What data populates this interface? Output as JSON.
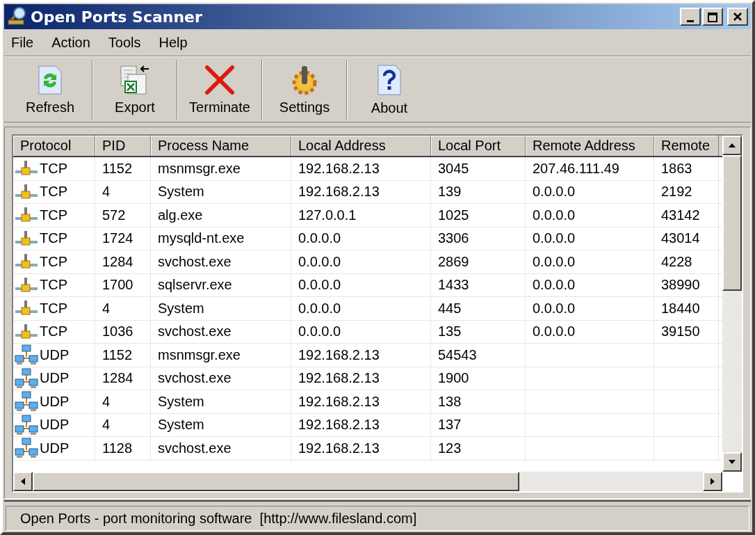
{
  "window": {
    "title": "Open Ports Scanner"
  },
  "menu": [
    "File",
    "Action",
    "Tools",
    "Help"
  ],
  "toolbar": [
    {
      "kind": "refresh",
      "label": "Refresh"
    },
    {
      "kind": "export",
      "label": "Export"
    },
    {
      "kind": "terminate",
      "label": "Terminate"
    },
    {
      "kind": "settings",
      "label": "Settings"
    },
    {
      "kind": "about",
      "label": "About"
    }
  ],
  "table": {
    "columns": [
      "Protocol",
      "PID",
      "Process Name",
      "Local Address",
      "Local Port",
      "Remote Address",
      "Remote"
    ],
    "rows": [
      {
        "kind": "tcp",
        "cells": [
          "TCP",
          "1152",
          "msnmsgr.exe",
          "192.168.2.13",
          "3045",
          "207.46.111.49",
          "1863"
        ]
      },
      {
        "kind": "tcp",
        "cells": [
          "TCP",
          "4",
          "System",
          "192.168.2.13",
          "139",
          "0.0.0.0",
          "2192"
        ]
      },
      {
        "kind": "tcp",
        "cells": [
          "TCP",
          "572",
          "alg.exe",
          "127.0.0.1",
          "1025",
          "0.0.0.0",
          "43142"
        ]
      },
      {
        "kind": "tcp",
        "cells": [
          "TCP",
          "1724",
          "mysqld-nt.exe",
          "0.0.0.0",
          "3306",
          "0.0.0.0",
          "43014"
        ]
      },
      {
        "kind": "tcp",
        "cells": [
          "TCP",
          "1284",
          "svchost.exe",
          "0.0.0.0",
          "2869",
          "0.0.0.0",
          "4228"
        ]
      },
      {
        "kind": "tcp",
        "cells": [
          "TCP",
          "1700",
          "sqlservr.exe",
          "0.0.0.0",
          "1433",
          "0.0.0.0",
          "38990"
        ]
      },
      {
        "kind": "tcp",
        "cells": [
          "TCP",
          "4",
          "System",
          "0.0.0.0",
          "445",
          "0.0.0.0",
          "18440"
        ]
      },
      {
        "kind": "tcp",
        "cells": [
          "TCP",
          "1036",
          "svchost.exe",
          "0.0.0.0",
          "135",
          "0.0.0.0",
          "39150"
        ]
      },
      {
        "kind": "udp",
        "cells": [
          "UDP",
          "1152",
          "msnmsgr.exe",
          "192.168.2.13",
          "54543"
        ]
      },
      {
        "kind": "udp",
        "cells": [
          "UDP",
          "1284",
          "svchost.exe",
          "192.168.2.13",
          "1900"
        ]
      },
      {
        "kind": "udp",
        "cells": [
          "UDP",
          "4",
          "System",
          "192.168.2.13",
          "138"
        ]
      },
      {
        "kind": "udp",
        "cells": [
          "UDP",
          "4",
          "System",
          "192.168.2.13",
          "137"
        ]
      },
      {
        "kind": "udp",
        "cells": [
          "UDP",
          "1128",
          "svchost.exe",
          "192.168.2.13",
          "123"
        ]
      }
    ]
  },
  "status_bar": "Open Ports - port monitoring software  [http://www.filesland.com]"
}
